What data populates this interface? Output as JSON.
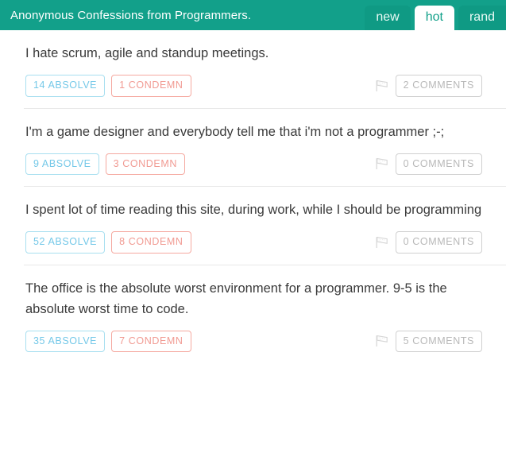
{
  "header": {
    "title": "Anonymous Confessions from Programmers.",
    "brand_color": "#12a08a",
    "tabs": [
      {
        "label": "new",
        "active": false
      },
      {
        "label": "hot",
        "active": true
      },
      {
        "label": "rand",
        "active": false
      }
    ]
  },
  "colors": {
    "header_bg": "#12a08a",
    "absolve_border": "#a8dff0",
    "absolve_text": "#74c8e8",
    "condemn_border": "#f5a9a0",
    "condemn_text": "#f19a92",
    "comments_border": "#d0d0d0",
    "comments_text": "#b8b8b8",
    "post_text": "#3a3a3a",
    "divider": "#e8e8e8"
  },
  "icons": {
    "flag": "flag-icon"
  },
  "posts": [
    {
      "text": "I hate scrum, agile and standup meetings.",
      "absolve_label": "14 ABSOLVE",
      "condemn_label": "1 CONDEMN",
      "comments_label": "2 COMMENTS",
      "absolve_count": 14,
      "condemn_count": 1,
      "comments_count": 2
    },
    {
      "text": "I'm a game designer and everybody tell me that i'm not a programmer ;-;",
      "absolve_label": "9 ABSOLVE",
      "condemn_label": "3 CONDEMN",
      "comments_label": "0 COMMENTS",
      "absolve_count": 9,
      "condemn_count": 3,
      "comments_count": 0
    },
    {
      "text": "I spent lot of time reading this site, during work, while I should be programming",
      "absolve_label": "52 ABSOLVE",
      "condemn_label": "8 CONDEMN",
      "comments_label": "0 COMMENTS",
      "absolve_count": 52,
      "condemn_count": 8,
      "comments_count": 0
    },
    {
      "text": "The office is the absolute worst environment for a programmer. 9-5 is the absolute worst time to code.",
      "absolve_label": "35 ABSOLVE",
      "condemn_label": "7 CONDEMN",
      "comments_label": "5 COMMENTS",
      "absolve_count": 35,
      "condemn_count": 7,
      "comments_count": 5
    }
  ]
}
